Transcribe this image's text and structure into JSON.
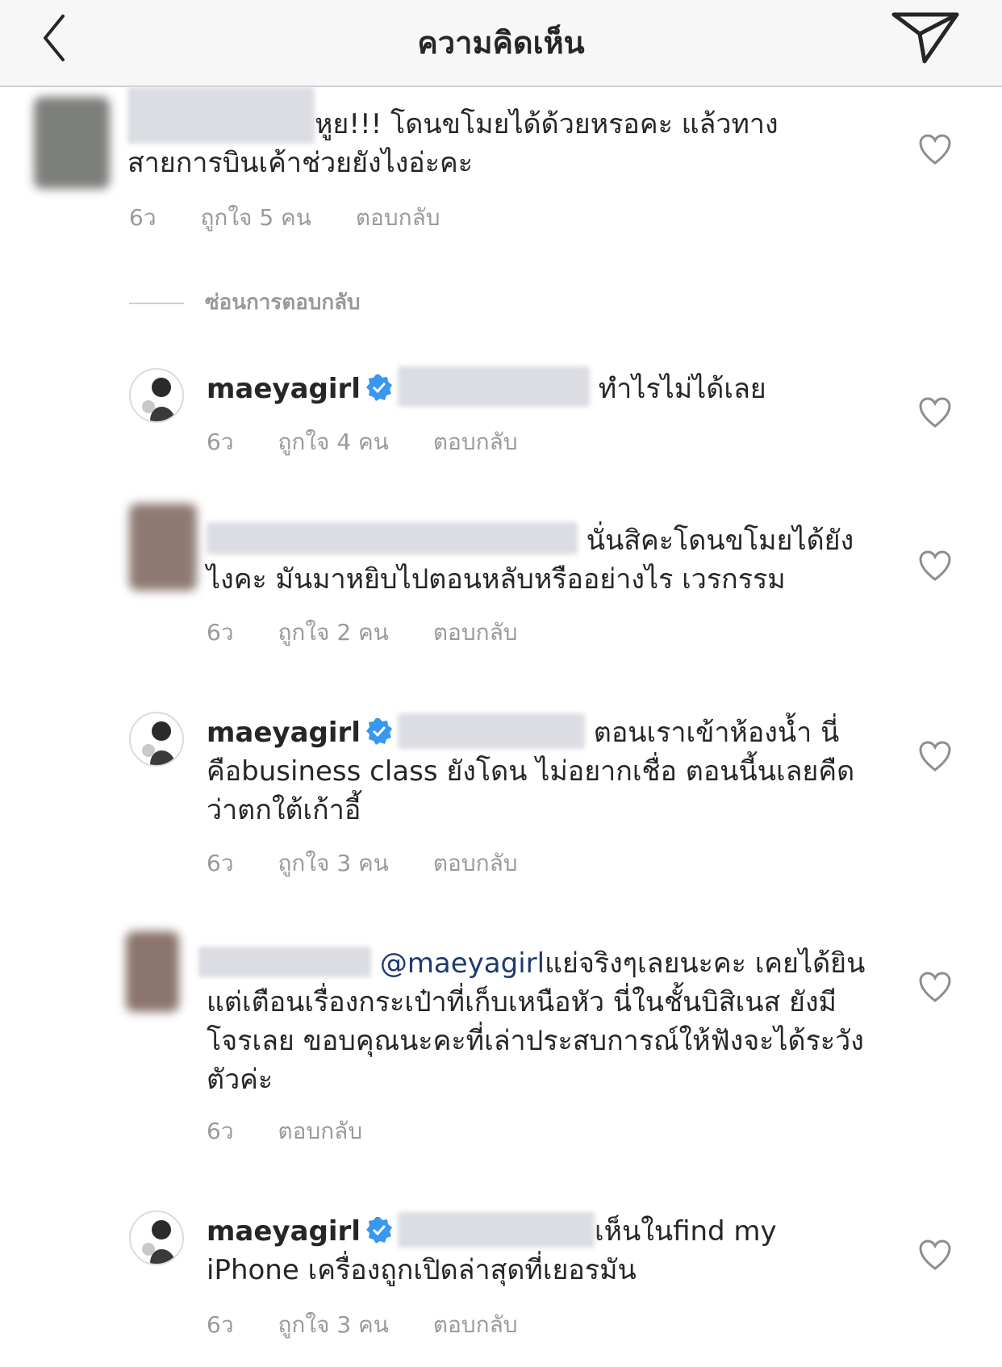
{
  "header": {
    "title": "ความคิดเห็น"
  },
  "hide_replies": {
    "label": "ซ่อนการตอบกลับ"
  },
  "comments": [
    {
      "text": "หูย!!! โดนขโมยได้ด้วยหรอคะ  แล้วทางสายการบินเค้าช่วยยังไงอ่ะคะ",
      "time": "6ว",
      "likes": "ถูกใจ 5 คน",
      "reply": "ตอบกลับ"
    },
    {
      "username": "maeyagirl",
      "text": " ทำไรไม่ได้เลย",
      "time": "6ว",
      "likes": "ถูกใจ 4 คน",
      "reply": "ตอบกลับ"
    },
    {
      "text": " นั่นสิคะโดนขโมยได้ยังไงคะ มันมาหยิบไปตอนหลับหรืออย่างไร เวรกรรม",
      "time": "6ว",
      "likes": "ถูกใจ 2 คน",
      "reply": "ตอบกลับ"
    },
    {
      "username": "maeyagirl",
      "text": " ตอนเราเข้าห้องน้ำ นี่คือbusiness class ยังโดน ไม่อยากเชื่อ ตอนนี้นเลยคืดว่าตกใต้เก้าอี้",
      "time": "6ว",
      "likes": "ถูกใจ 3 คน",
      "reply": "ตอบกลับ"
    },
    {
      "mention": "@maeyagirl",
      "text": "แย่จริงๆเลยนะคะ เคยได้ยินแต่เตือนเรื่องกระเป๋าที่เก็บเหนือหัว นี่ในชั้นบิสิเนส ยังมีโจรเลย ขอบคุณนะคะที่เล่าประสบการณ์ให้ฟังจะได้ระวังตัวค่ะ",
      "time": "6ว",
      "reply": "ตอบกลับ"
    },
    {
      "username": "maeyagirl",
      "text": "เห็นในfind my iPhone เครื่องถูกเปิดล่าสุดที่เยอรมัน",
      "time": "6ว",
      "likes": "ถูกใจ 3 คน",
      "reply": "ตอบกลับ"
    }
  ]
}
